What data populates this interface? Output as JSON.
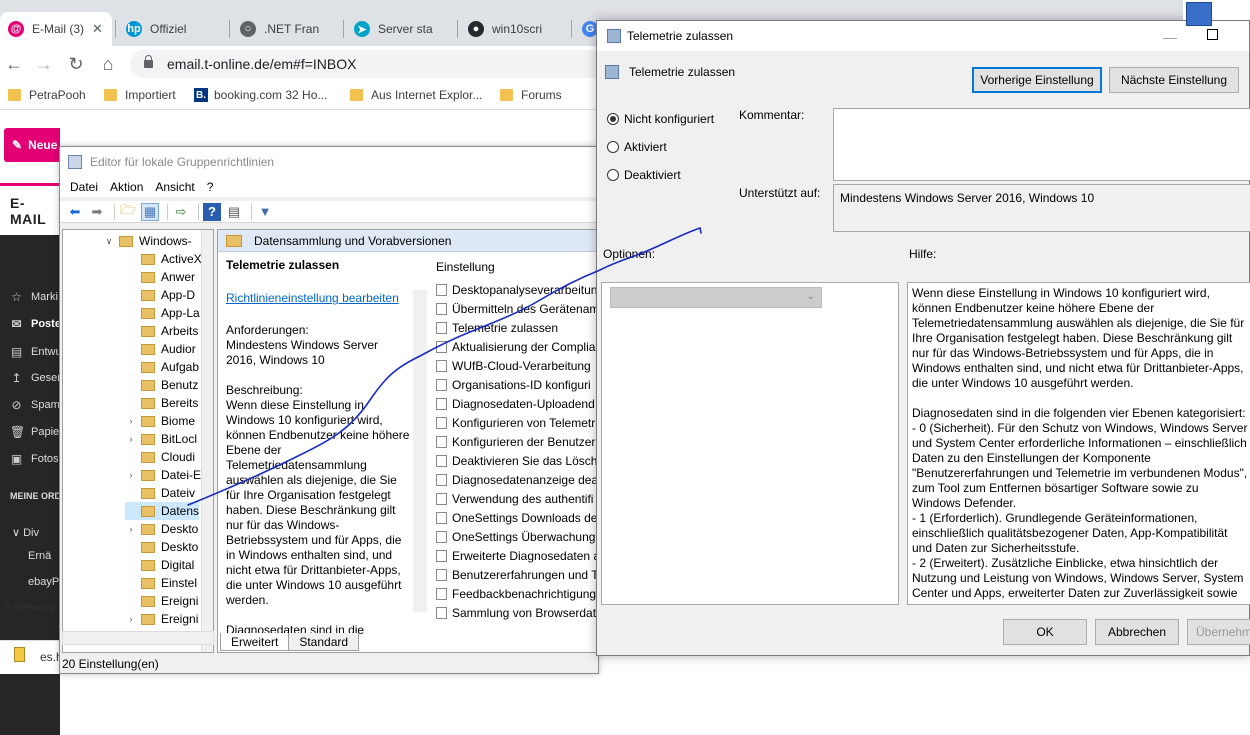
{
  "browser": {
    "tabs": [
      {
        "label": "E-Mail (3)",
        "icon": "email-icon",
        "color": "#e20074",
        "active": true
      },
      {
        "label": "Offiziel",
        "icon": "hp-icon",
        "color": "#0096d6"
      },
      {
        "label": ".NET Fran",
        "icon": "globe-icon",
        "color": "#5f6368"
      },
      {
        "label": "Server sta",
        "icon": "server-icon",
        "color": "#00a4c8"
      },
      {
        "label": "win10scri",
        "icon": "github-icon",
        "color": "#24292e"
      },
      {
        "label": "G",
        "icon": "google-icon",
        "color": "#4285f4"
      }
    ],
    "address": "email.t-online.de/em#f=INBOX",
    "bookmarks": [
      {
        "label": "PetraPooh",
        "icon": "folder-icon"
      },
      {
        "label": "Importiert",
        "icon": "folder-icon"
      },
      {
        "label": "booking.com 32 Ho...",
        "icon": "booking-icon",
        "badge": "B."
      },
      {
        "label": "Aus Internet Explor...",
        "icon": "folder-icon"
      },
      {
        "label": "Forums",
        "icon": "folder-icon"
      }
    ]
  },
  "email": {
    "label": "E-MAIL",
    "new_button": "Neue",
    "nav": [
      {
        "label": "Marki",
        "icon": "star"
      },
      {
        "label": "Poste",
        "icon": "inbox",
        "selected": true
      },
      {
        "label": "Entwu",
        "icon": "draft"
      },
      {
        "label": "Geser",
        "icon": "send"
      },
      {
        "label": "Spam",
        "icon": "block"
      },
      {
        "label": "Papie",
        "icon": "trash"
      },
      {
        "label": "Fotos",
        "icon": "photo"
      }
    ],
    "section": "MEINE ORDI",
    "subfolders": [
      "Div",
      "Ernä",
      "ebayPa"
    ],
    "footer": "© Telekom D",
    "download_file": "es.h"
  },
  "gpedit": {
    "title": "Editor für lokale Gruppenrichtlinien",
    "menu": [
      "Datei",
      "Aktion",
      "Ansicht",
      "?"
    ],
    "tree": [
      {
        "label": "Windows-",
        "exp": "open",
        "indent": 0
      },
      {
        "label": "ActiveX",
        "exp": "",
        "indent": 1
      },
      {
        "label": "Anwer",
        "exp": "",
        "indent": 1
      },
      {
        "label": "App-D",
        "exp": "",
        "indent": 1
      },
      {
        "label": "App-La",
        "exp": "",
        "indent": 1
      },
      {
        "label": "Arbeits",
        "exp": "",
        "indent": 1
      },
      {
        "label": "Audior",
        "exp": "",
        "indent": 1
      },
      {
        "label": "Aufgab",
        "exp": "",
        "indent": 1
      },
      {
        "label": "Benutz",
        "exp": "",
        "indent": 1
      },
      {
        "label": "Bereits",
        "exp": "",
        "indent": 1
      },
      {
        "label": "Biome",
        "exp": "closed",
        "indent": 1
      },
      {
        "label": "BitLocl",
        "exp": "closed",
        "indent": 1
      },
      {
        "label": "Cloudi",
        "exp": "",
        "indent": 1
      },
      {
        "label": "Datei-E",
        "exp": "closed",
        "indent": 1
      },
      {
        "label": "Dateiv",
        "exp": "",
        "indent": 1
      },
      {
        "label": "Datens",
        "exp": "",
        "indent": 1,
        "selected": true
      },
      {
        "label": "Deskto",
        "exp": "closed",
        "indent": 1
      },
      {
        "label": "Deskto",
        "exp": "",
        "indent": 1
      },
      {
        "label": "Digital",
        "exp": "",
        "indent": 1
      },
      {
        "label": "Einstel",
        "exp": "",
        "indent": 1
      },
      {
        "label": "Ereigni",
        "exp": "",
        "indent": 1
      },
      {
        "label": "Ereigni",
        "exp": "closed",
        "indent": 1
      }
    ],
    "folder_header": "Datensammlung und Vorabversionen",
    "desc": {
      "title": "Telemetrie zulassen",
      "link": "Richtlinieneinstellung bearbeiten",
      "req_label": "Anforderungen:",
      "req_value": "Mindestens Windows Server 2016, Windows 10",
      "desc_label": "Beschreibung:",
      "desc_text": "Wenn diese Einstellung in Windows 10 konfiguriert wird, können Endbenutzer keine höhere Ebene der Telemetriedatensammlung auswählen als diejenige, die Sie für Ihre Organisation festgelegt haben. Diese Beschränkung gilt nur für das Windows-Betriebssystem und für Apps, die in Windows enthalten sind, und nicht etwa für Drittanbieter-Apps, die unter Windows 10 ausgeführt werden.",
      "desc_more": "Diagnosedaten sind in die"
    },
    "list_header": "Einstellung",
    "list": [
      "Desktopanalyseverarbeitun",
      "Übermitteln des Gerätenam",
      "Telemetrie zulassen",
      "Aktualisierung der Complia",
      "WUfB-Cloud-Verarbeitung",
      "Organisations-ID konfiguri",
      "Diagnosedaten-Uploadend",
      "Konfigurieren von Telemetr",
      "Konfigurieren der Benutzer",
      "Deaktivieren Sie das Lösche",
      "Diagnosedatenanzeige dea",
      "Verwendung des authentifi",
      "OneSettings Downloads de",
      "OneSettings Überwachung",
      "Erweiterte Diagnosedaten a",
      "Benutzererfahrungen und T",
      "Feedbackbenachrichtigung",
      "Sammlung von Browserdat"
    ],
    "tabs": [
      "Erweitert",
      "Standard"
    ],
    "status": "20 Einstellung(en)"
  },
  "dialog": {
    "title": "Telemetrie zulassen",
    "header": "Telemetrie zulassen",
    "prev_button": "Vorherige Einstellung",
    "next_button": "Nächste Einstellung",
    "radios": [
      "Nicht konfiguriert",
      "Aktiviert",
      "Deaktiviert"
    ],
    "comment_label": "Kommentar:",
    "supported_label": "Unterstützt auf:",
    "supported_value": "Mindestens Windows Server 2016, Windows 10",
    "options_label": "Optionen:",
    "help_label": "Hilfe:",
    "help_paragraphs": [
      "Wenn diese Einstellung in Windows 10 konfiguriert wird, können Endbenutzer keine höhere Ebene der Telemetriedatensammlung auswählen als diejenige, die Sie für Ihre Organisation festgelegt haben. Diese Beschränkung gilt nur für das Windows-Betriebssystem und für Apps, die in Windows enthalten sind, und nicht etwa für Drittanbieter-Apps, die unter Windows 10 ausgeführt werden.",
      "Diagnosedaten sind in die folgenden vier Ebenen kategorisiert:\n  - 0 (Sicherheit). Für den Schutz von Windows, Windows Server und System Center erforderliche Informationen – einschließlich Daten zu den Einstellungen der Komponente \"Benutzererfahrungen und Telemetrie im verbundenen Modus\", zum Tool zum Entfernen bösartiger Software sowie zu Windows Defender.\n  - 1 (Erforderlich). Grundlegende Geräteinformationen, einschließlich qualitätsbezogener Daten, App-Kompatibilität und Daten zur Sicherheitsstufe.\n  - 2 (Erweitert). Zusätzliche Einblicke, etwa hinsichtlich der Nutzung und Leistung von Windows, Windows Server, System Center und Apps, erweiterter Daten zur Zuverlässigkeit sowie"
    ],
    "ok": "OK",
    "cancel": "Abbrechen",
    "apply": "Übernehm"
  }
}
